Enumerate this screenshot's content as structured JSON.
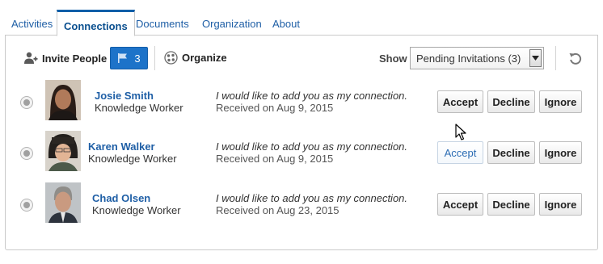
{
  "tabs": [
    {
      "label": "Activities"
    },
    {
      "label": "Connections"
    },
    {
      "label": "Documents"
    },
    {
      "label": "Organization"
    },
    {
      "label": "About"
    }
  ],
  "toolbar": {
    "invite_label": "Invite People",
    "pending_count": "3",
    "organize_label": "Organize",
    "show_label": "Show",
    "show_value": "Pending Invitations (3)"
  },
  "invitations": [
    {
      "name": "Josie Smith",
      "role": "Knowledge Worker",
      "message": "I would like to add you as my connection.",
      "received": "Received on Aug 9, 2015"
    },
    {
      "name": "Karen Walker",
      "role": "Knowledge Worker",
      "message": "I would like to add you as my connection.",
      "received": "Received on Aug 9, 2015"
    },
    {
      "name": "Chad Olsen",
      "role": "Knowledge Worker",
      "message": "I would like to add you as my connection.",
      "received": "Received on Aug 23, 2015"
    }
  ],
  "actions": {
    "accept": "Accept",
    "decline": "Decline",
    "ignore": "Ignore"
  },
  "colors": {
    "accent": "#1d73c9",
    "link": "#1f5fa6",
    "tab_active_border": "#0a5ea8"
  }
}
